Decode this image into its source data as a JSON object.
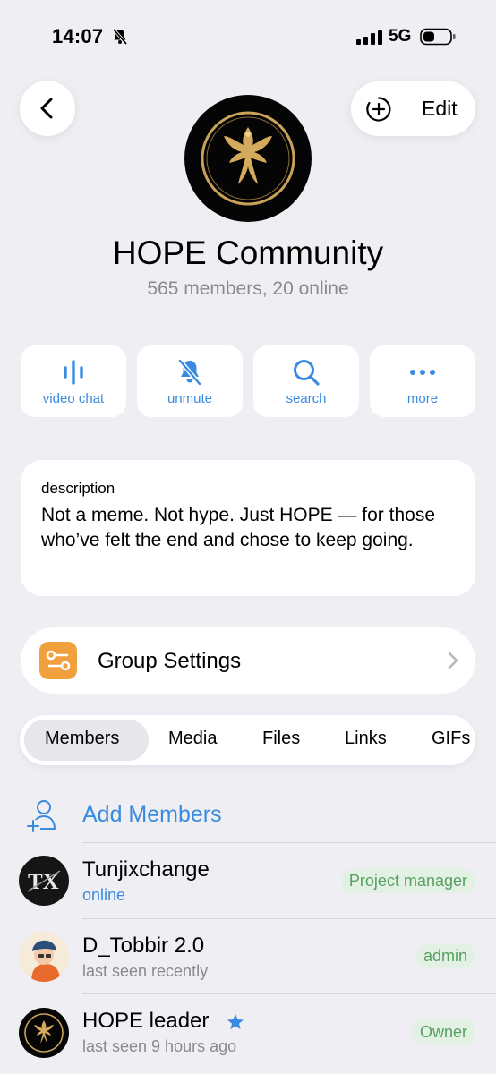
{
  "status_bar": {
    "time": "14:07",
    "network": "5G",
    "icons": [
      "bell-slash-icon",
      "signal-icon",
      "battery-icon"
    ]
  },
  "header": {
    "back_icon": "chevron-left-icon",
    "edit_label": "Edit",
    "edit_icon": "add-circle-icon"
  },
  "group": {
    "name": "HOPE Community",
    "subtitle": "565 members, 20 online",
    "avatar_icon": "phoenix-logo"
  },
  "actions": [
    {
      "label": "video chat",
      "icon": "voice-chat-icon"
    },
    {
      "label": "unmute",
      "icon": "bell-slash-icon"
    },
    {
      "label": "search",
      "icon": "search-icon"
    },
    {
      "label": "more",
      "icon": "more-dots-icon"
    }
  ],
  "description": {
    "label": "description",
    "text": "Not a meme. Not hype. Just HOPE — for those who’ve felt the end and chose to keep going."
  },
  "settings": {
    "label": "Group Settings",
    "icon": "sliders-icon"
  },
  "tabs": [
    {
      "label": "Members",
      "selected": true
    },
    {
      "label": "Media",
      "selected": false
    },
    {
      "label": "Files",
      "selected": false
    },
    {
      "label": "Links",
      "selected": false
    },
    {
      "label": "GIFs",
      "selected": false
    }
  ],
  "add_members": {
    "label": "Add Members",
    "icon": "add-user-icon"
  },
  "members": [
    {
      "name": "Tunjixchange",
      "status": "online",
      "badge": "Project manager"
    },
    {
      "name": "D_Tobbir 2.0",
      "status": "last seen recently",
      "badge": "admin"
    },
    {
      "name": "HOPE leader",
      "status": "last seen 9 hours ago",
      "badge": "Owner",
      "verified_icon": "star-icon"
    }
  ],
  "colors": {
    "accent": "#3a8be0",
    "badge_bg": "#e3f1e4",
    "badge_text": "#56a060",
    "settings_icon_bg": "#f0a13d",
    "background": "#eeeef3"
  }
}
